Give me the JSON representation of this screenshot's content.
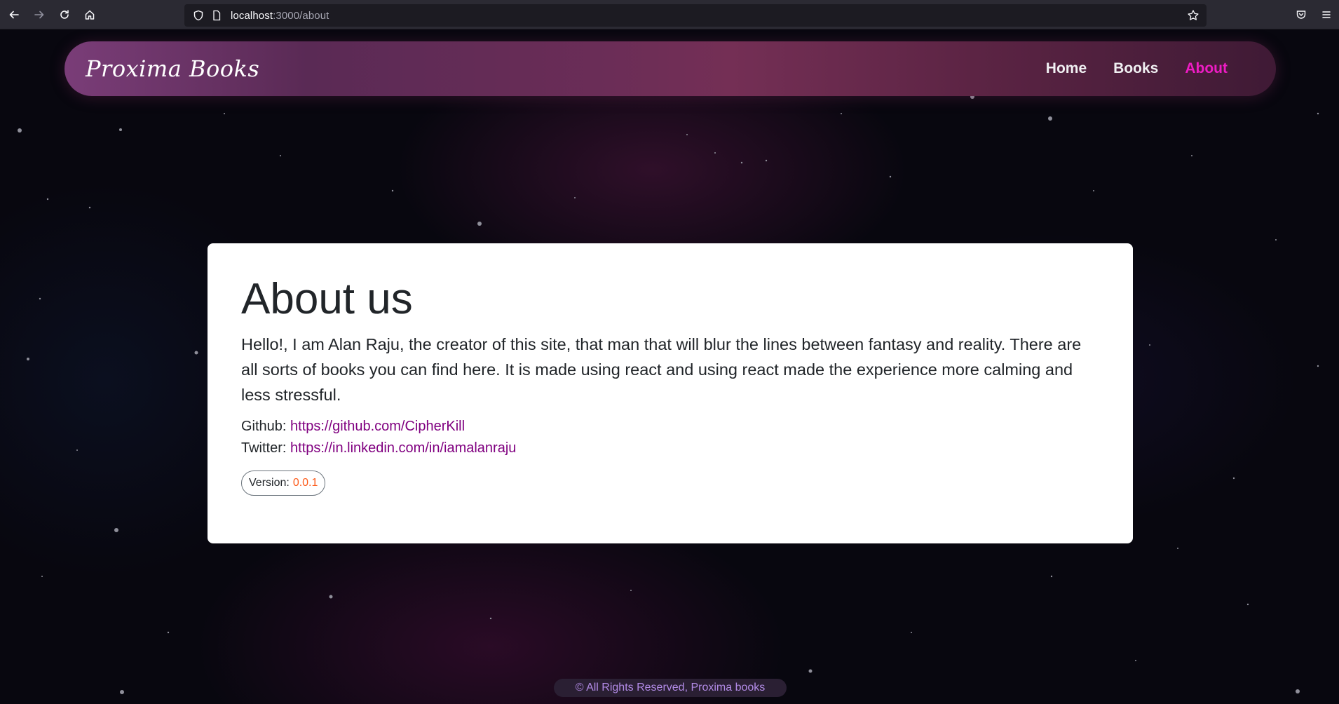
{
  "browser": {
    "url_host": "localhost",
    "url_path": ":3000/about"
  },
  "site": {
    "brand": "Proxima Books",
    "nav": [
      {
        "label": "Home",
        "active": false
      },
      {
        "label": "Books",
        "active": false
      },
      {
        "label": "About",
        "active": true
      }
    ]
  },
  "about": {
    "title": "About us",
    "intro": "Hello!, I am Alan Raju, the creator of this site, that man that will blur the lines between fantasy and reality. There are all sorts of books you can find here. It is made using react and using react made the experience more calming and less stressful.",
    "github_label": "Github:",
    "github_url": "https://github.com/CipherKill",
    "twitter_label": "Twitter:",
    "twitter_url": "https://in.linkedin.com/in/iamalanraju",
    "version_label": "Version:",
    "version_value": "0.0.1"
  },
  "footer": {
    "text": "© All Rights Reserved, Proxima books"
  },
  "colors": {
    "accent_active": "#ee1cc4",
    "link": "#800080",
    "version": "#fd5b1a",
    "footer_text": "#b28be6"
  }
}
